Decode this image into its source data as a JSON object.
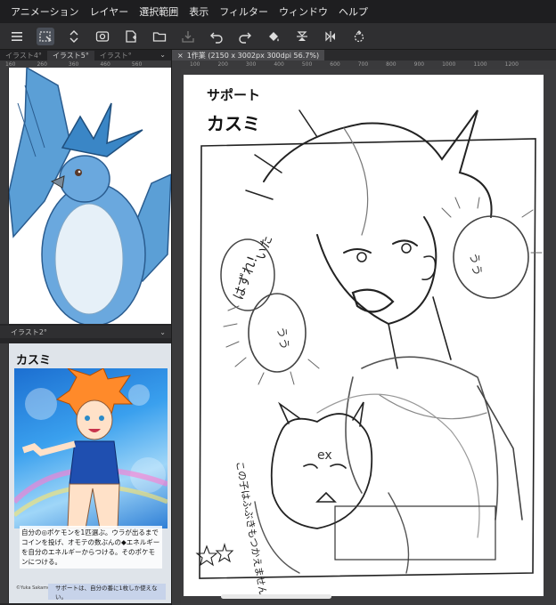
{
  "menu": {
    "items": [
      "アニメーション",
      "レイヤー",
      "選択範囲",
      "表示",
      "フィルター",
      "ウィンドウ",
      "ヘルプ"
    ]
  },
  "toolbar": {
    "icons": [
      "menu-icon",
      "layer-select-icon",
      "updown-icon",
      "view-icon",
      "new-canvas-icon",
      "open-icon",
      "save-icon",
      "undo-icon",
      "redo-icon",
      "fill-icon",
      "flip-vertical-icon",
      "flip-horizontal-icon",
      "rotate-icon"
    ]
  },
  "left_panel_top": {
    "tabs": [
      "イラスト4°",
      "イラスト5°",
      "イラスト°"
    ],
    "ruler": [
      "160",
      "260",
      "360",
      "460",
      "560"
    ]
  },
  "left_panel_bottom": {
    "header": "イラスト2°",
    "card": {
      "title": "カスミ",
      "text": "自分の◎ポケモンを1匹選ぶ。ウラが出るまでコインを投げ、オモテの数ぶんの◆エネルギーを自分のエネルギーからつける。そのポケモンにつける。",
      "bottom": "サポートは、自分の番に1枚しか使えない。",
      "credit": "©Yuka Sakamoto"
    }
  },
  "main": {
    "tab": "1作業 (2150 x 3002px 300dpi 56.7%)",
    "ruler": [
      "100",
      "200",
      "300",
      "400",
      "500",
      "600",
      "700",
      "800",
      "900",
      "1000",
      "1100",
      "1200"
    ],
    "sketch": {
      "label_support": "サポート",
      "label_name": "カスミ",
      "bubble_left": "はずれ!",
      "bubble_left2": "いた",
      "bubble_uu": "うう",
      "bubble_right": "うう",
      "note": "この子はふぶきもつかえません",
      "ex": "ex"
    }
  },
  "colors": {
    "app_bg": "#2b2b2d",
    "menubar": "#1e1e20",
    "paper": "#ffffff"
  }
}
